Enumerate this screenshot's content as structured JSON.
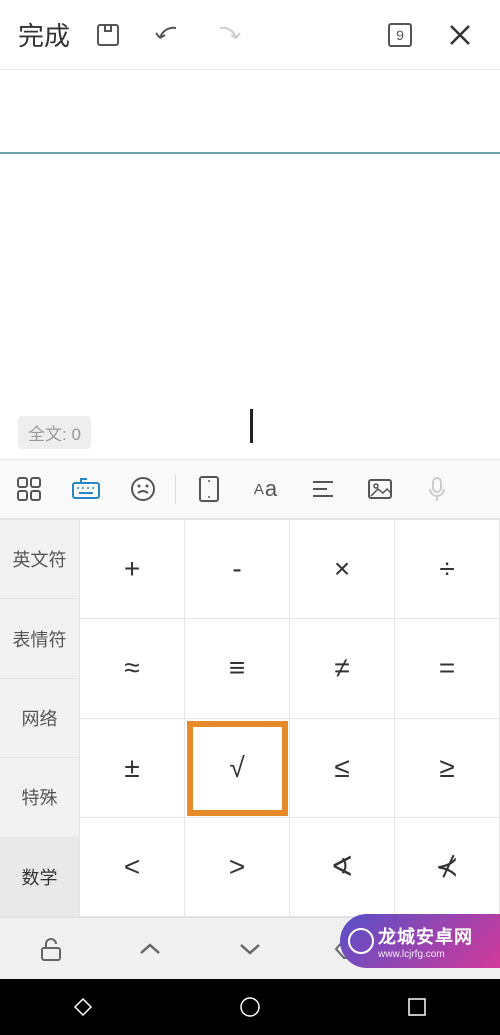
{
  "topbar": {
    "done": "完成",
    "counter": "9"
  },
  "textArea": "",
  "badge": "全文: 0",
  "categories": [
    "英文符",
    "表情符",
    "网络",
    "特殊",
    "数学"
  ],
  "keys": [
    [
      "+",
      "-",
      "×",
      "÷"
    ],
    [
      "≈",
      "≡",
      "≠",
      "="
    ],
    [
      "±",
      "√",
      "≤",
      "≥"
    ],
    [
      "<",
      ">",
      "∢",
      "⊀"
    ]
  ],
  "activeCategoryIndex": 4,
  "highlightedKey": [
    2,
    1
  ],
  "bottom": {
    "back": "返回"
  },
  "watermark": {
    "title": "龙城安卓网",
    "sub": "www.lcjrfg.com"
  }
}
